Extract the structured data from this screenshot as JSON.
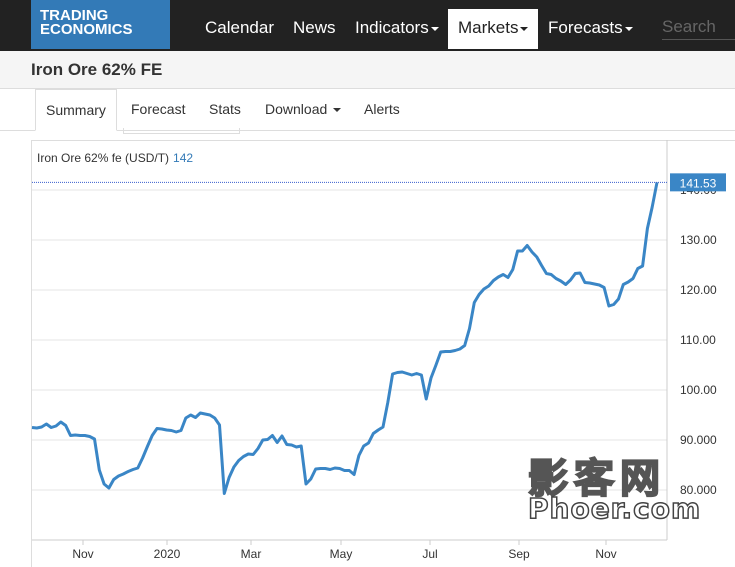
{
  "brand": {
    "line1": "TRADING",
    "line2": "ECONOMICS",
    "color": "#337ab7"
  },
  "nav": {
    "items": [
      "Calendar",
      "News",
      "Indicators",
      "Markets",
      "Forecasts"
    ],
    "active": "Markets",
    "search_placeholder": "Search"
  },
  "page": {
    "title": "Iron Ore 62% FE"
  },
  "tabs": [
    "Summary",
    "Forecast",
    "Stats",
    "Download",
    "Alerts"
  ],
  "legend": {
    "series": "Iron Ore 62% fe (USD/T)",
    "value": "142"
  },
  "watermark": {
    "cn": "影客网",
    "en": "Phoer.com"
  },
  "chart_data": {
    "type": "line",
    "title": "",
    "xlabel": "",
    "ylabel": "",
    "x_ticks": [
      "Nov",
      "2020",
      "Mar",
      "May",
      "Jul",
      "Sep",
      "Nov"
    ],
    "y_ticks": [
      "80.000",
      "90.000",
      "100.00",
      "110.00",
      "120.00",
      "130.00",
      "140.00"
    ],
    "ylim": [
      76.5,
      151
    ],
    "last_value_label": "141.53",
    "last_value": 141.53,
    "line_color": "#3a86c6",
    "series": [
      {
        "name": "Iron Ore 62% fe (USD/T)",
        "values": [
          92.5,
          92.4,
          92.6,
          93.2,
          92.5,
          92.8,
          93.6,
          92.9,
          90.9,
          91,
          90.9,
          90.9,
          90.7,
          90.2,
          84,
          81.2,
          80.4,
          82.1,
          82.8,
          83.2,
          83.7,
          84.1,
          84.4,
          86.4,
          88.7,
          90.9,
          92.3,
          92.2,
          92.0,
          91.9,
          91.6,
          91.9,
          94.4,
          95.0,
          94.5,
          95.4,
          95.2,
          95.0,
          94.4,
          93.0,
          79.3,
          82.5,
          84.6,
          85.9,
          86.7,
          87.2,
          87.1,
          88.3,
          90.0,
          90.1,
          90.9,
          89.5,
          90.8,
          89.1,
          89.0,
          88.6,
          88.8,
          81.2,
          82.2,
          84.2,
          84.3,
          84.3,
          84.1,
          84.4,
          84.3,
          83.9,
          83.9,
          83.1,
          86.9,
          88.8,
          89.4,
          91.3,
          92.0,
          92.6,
          97.5,
          103.2,
          103.5,
          103.6,
          103.3,
          103.0,
          103.3,
          103.0,
          98.2,
          102.4,
          104.9,
          107.6,
          107.7,
          107.7,
          107.9,
          108.2,
          108.9,
          112.3,
          117.5,
          119.1,
          120.2,
          120.8,
          121.9,
          122.6,
          123.1,
          122.5,
          124.1,
          127.8,
          127.8,
          128.9,
          127.6,
          126.6,
          124.9,
          123.3,
          123.1,
          122.3,
          121.8,
          121.1,
          122.0,
          123.3,
          123.4,
          121.5,
          121.4,
          121.2,
          121.0,
          120.5,
          116.8,
          117.1,
          118.2,
          121.1,
          121.6,
          122.3,
          124.3,
          124.8,
          132.3,
          136.6,
          141.53
        ]
      }
    ]
  }
}
